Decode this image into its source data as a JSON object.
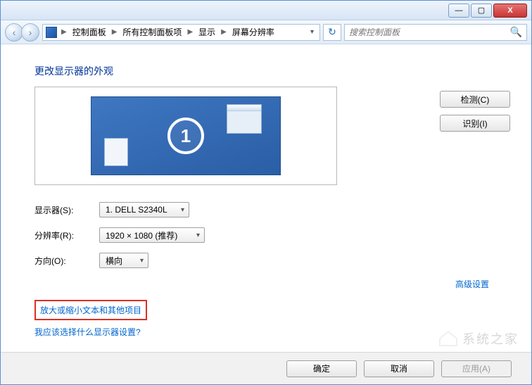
{
  "titlebar": {
    "min": "—",
    "max": "▢",
    "close": "X"
  },
  "nav": {
    "back": "‹",
    "forward": "›",
    "crumbs": [
      "控制面板",
      "所有控制面板项",
      "显示",
      "屏幕分辨率"
    ],
    "refresh": "↻",
    "search_placeholder": "搜索控制面板"
  },
  "heading": "更改显示器的外观",
  "monitor_number": "1",
  "buttons": {
    "detect": "检测(C)",
    "identify": "识别(I)"
  },
  "form": {
    "display_label": "显示器(S):",
    "display_value": "1. DELL S2340L",
    "resolution_label": "分辨率(R):",
    "resolution_value": "1920 × 1080 (推荐)",
    "orientation_label": "方向(O):",
    "orientation_value": "横向"
  },
  "advanced_link": "高级设置",
  "links": {
    "text_size": "放大或缩小文本和其他项目",
    "which_settings": "我应该选择什么显示器设置?"
  },
  "footer": {
    "ok": "确定",
    "cancel": "取消",
    "apply": "应用(A)"
  },
  "watermark": "系统之家"
}
